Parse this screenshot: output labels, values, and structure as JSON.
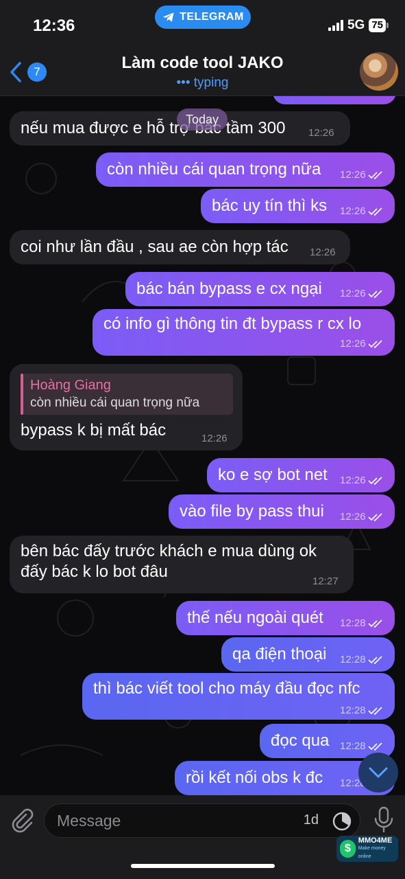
{
  "status_bar": {
    "time": "12:36",
    "app_pill": "TELEGRAM",
    "network": "5G",
    "battery": "75"
  },
  "header": {
    "back_count": "7",
    "title": "Làm code tool JAKO",
    "status": "typing"
  },
  "chat": {
    "date_divider": "Today",
    "messages": [
      {
        "dir": "in",
        "text": "nếu mua được e hỗ trợ bác tầm 300",
        "time": "12:26"
      },
      {
        "dir": "out",
        "text": "còn nhiều cái quan trọng nữa",
        "time": "12:26"
      },
      {
        "dir": "out",
        "text": "bác uy tín thì ks",
        "time": "12:26"
      },
      {
        "dir": "in",
        "text": "coi như lần đầu , sau ae còn hợp tác",
        "time": "12:26"
      },
      {
        "dir": "out",
        "text": "bác bán bypass e cx ngại",
        "time": "12:26"
      },
      {
        "dir": "out",
        "text": "có info gì thông tin đt bypass r cx lo",
        "time": "12:26"
      },
      {
        "dir": "in",
        "reply_name": "Hoàng Giang",
        "reply_text": "còn nhiều cái quan trọng nữa",
        "text": "bypass k bị mất bác",
        "time": "12:26"
      },
      {
        "dir": "out",
        "text": "ko e sợ bot net",
        "time": "12:26"
      },
      {
        "dir": "out",
        "text": "vào file by pass thui",
        "time": "12:26"
      },
      {
        "dir": "in",
        "text": "bên bác đấy trước khách e mua dùng ok",
        "text2": "đấy bác k lo bot đâu",
        "time": "12:27"
      },
      {
        "dir": "out",
        "text": "thế nếu ngoài quét",
        "time": "12:28"
      },
      {
        "dir": "out",
        "text": "qa điện thoại",
        "time": "12:28"
      },
      {
        "dir": "out",
        "text": "thì bác viết tool cho máy đầu đọc nfc",
        "time": "12:28"
      },
      {
        "dir": "out",
        "text": "đọc qua",
        "time": "12:28"
      },
      {
        "dir": "out",
        "text": "rồi kết nối obs k đc",
        "time": "12:28"
      }
    ]
  },
  "input": {
    "placeholder": "Message",
    "timer": "1d"
  },
  "watermark": {
    "brand": "MMO4ME",
    "tagline": "Make money online"
  },
  "colors": {
    "accent": "#2f89f5",
    "outgoing": "#8a56f0",
    "incoming": "#232226",
    "reply_bar": "#d55f94"
  }
}
